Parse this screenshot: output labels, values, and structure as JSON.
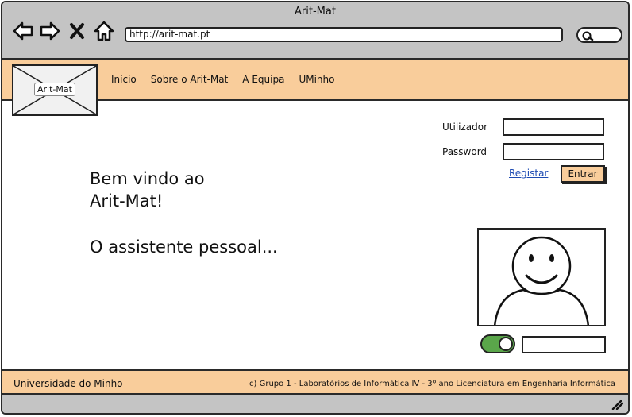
{
  "window": {
    "title": "Arit-Mat"
  },
  "browser": {
    "url": "http://arit-mat.pt",
    "nav_icons": [
      "back-arrow-icon",
      "forward-arrow-icon",
      "close-x-icon",
      "home-icon"
    ],
    "search_icon": "search-icon"
  },
  "header": {
    "logo_label": "Arit-Mat",
    "menu": [
      "Início",
      "Sobre o Arit-Mat",
      "A Equipa",
      "UMinho"
    ]
  },
  "login": {
    "user_label": "Utilizador",
    "password_label": "Password",
    "user_value": "",
    "password_value": "",
    "register_label": "Registar",
    "enter_label": "Entrar"
  },
  "main": {
    "welcome_line1": "Bem vindo ao",
    "welcome_line2": "Arit-Mat!",
    "subtitle": "O assistente pessoal..."
  },
  "assistant": {
    "avatar_icon": "smiley-user-icon",
    "toggle_on": true,
    "toggle_field_value": ""
  },
  "footer": {
    "left": "Universidade do Minho",
    "right": "c) Grupo 1 - Laboratórios de Informática IV - 3º ano Licenciatura em Engenharia Informática"
  },
  "colors": {
    "accent": "#f9cd9b",
    "chrome": "#c4c4c4",
    "link": "#1d4bb3",
    "toggle_on": "#5aa64a"
  }
}
